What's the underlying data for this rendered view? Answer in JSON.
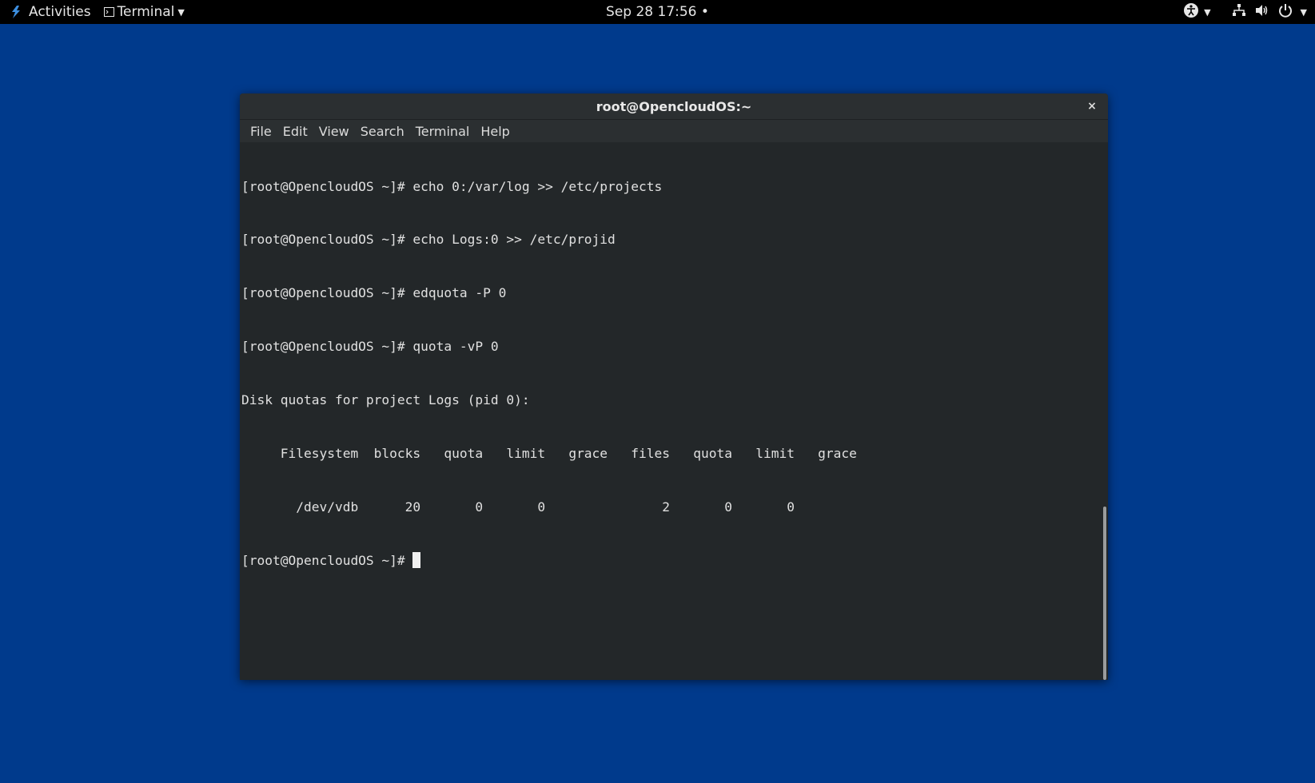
{
  "topbar": {
    "activities": "Activities",
    "app_name": "Terminal",
    "clock": "Sep 28  17:56",
    "clock_dot": "•"
  },
  "window": {
    "title": "root@OpencloudOS:~",
    "close": "×",
    "menu": [
      "File",
      "Edit",
      "View",
      "Search",
      "Terminal",
      "Help"
    ]
  },
  "terminal": {
    "lines": [
      "[root@OpencloudOS ~]# echo 0:/var/log >> /etc/projects",
      "[root@OpencloudOS ~]# echo Logs:0 >> /etc/projid",
      "[root@OpencloudOS ~]# edquota -P 0",
      "[root@OpencloudOS ~]# quota -vP 0",
      "Disk quotas for project Logs (pid 0):",
      "     Filesystem  blocks   quota   limit   grace   files   quota   limit   grace",
      "       /dev/vdb      20       0       0               2       0       0"
    ],
    "prompt": "[root@OpencloudOS ~]# "
  },
  "icons": {
    "activities_logo": "opencloudos-logo-icon",
    "terminal_app": "terminal-icon",
    "accessibility": "accessibility-icon",
    "network": "network-icon",
    "volume": "volume-icon",
    "power": "power-icon"
  },
  "colors": {
    "desktop": "#003a8c",
    "topbar": "#000000",
    "terminal_bg": "#232729",
    "terminal_fg": "#e0e0e0",
    "logo_accent": "#3d8fe0"
  }
}
